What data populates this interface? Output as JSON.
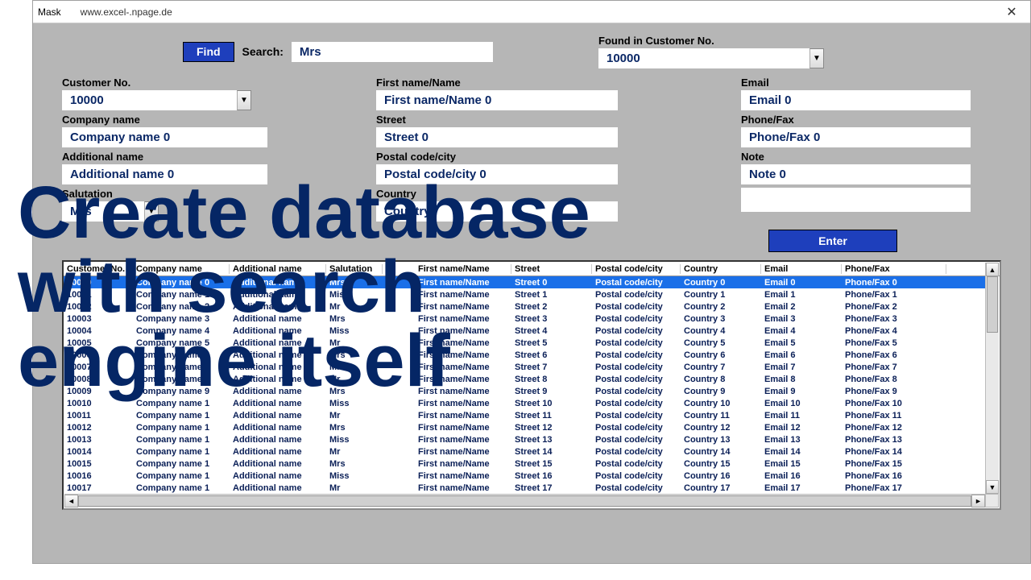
{
  "window": {
    "title": "Mask",
    "url": "www.excel-.npage.de"
  },
  "top": {
    "find_label": "Find",
    "search_label": "Search:",
    "search_value": "Mrs",
    "found_label": "Found in Customer No.",
    "found_value": "10000"
  },
  "fields": {
    "customer_label": "Customer No.",
    "customer_value": "10000",
    "company_label": "Company name",
    "company_value": "Company name 0",
    "addname_label": "Additional name",
    "addname_value": "Additional name 0",
    "salutation_label": "Salutation",
    "salutation_value": "Mrs",
    "firstname_label": "First name/Name",
    "firstname_value": "First name/Name 0",
    "street_label": "Street",
    "street_value": "Street 0",
    "postal_label": "Postal code/city",
    "postal_value": "Postal code/city 0",
    "country_label": "Country",
    "country_value": "Country",
    "email_label": "Email",
    "email_value": "Email 0",
    "phone_label": "Phone/Fax",
    "phone_value": "Phone/Fax 0",
    "note_label": "Note",
    "note_value": "Note 0",
    "enter_label": "Enter"
  },
  "headers": [
    "Customer No.",
    "Company name",
    "Additional name",
    "Salutation",
    "",
    "First name/Name",
    "Street",
    "Postal code/city",
    "Country",
    "Email",
    "Phone/Fax"
  ],
  "rows": [
    {
      "id": "10000",
      "co": "Company name 0",
      "ad": "Additional name",
      "sal": "Mrs",
      "fn": "First name/Name",
      "st": "Street 0",
      "pc": "Postal code/city",
      "cn": "Country 0",
      "em": "Email 0",
      "ph": "Phone/Fax 0",
      "sel": true
    },
    {
      "id": "10001",
      "co": "Company name 1",
      "ad": "Additional name",
      "sal": "Miss",
      "fn": "First name/Name",
      "st": "Street 1",
      "pc": "Postal code/city",
      "cn": "Country 1",
      "em": "Email 1",
      "ph": "Phone/Fax 1"
    },
    {
      "id": "10002",
      "co": "Company name 2",
      "ad": "Additional name",
      "sal": "Mr",
      "fn": "First name/Name",
      "st": "Street 2",
      "pc": "Postal code/city",
      "cn": "Country 2",
      "em": "Email 2",
      "ph": "Phone/Fax 2"
    },
    {
      "id": "10003",
      "co": "Company name 3",
      "ad": "Additional name",
      "sal": "Mrs",
      "fn": "First name/Name",
      "st": "Street 3",
      "pc": "Postal code/city",
      "cn": "Country 3",
      "em": "Email 3",
      "ph": "Phone/Fax 3"
    },
    {
      "id": "10004",
      "co": "Company name 4",
      "ad": "Additional name",
      "sal": "Miss",
      "fn": "First name/Name",
      "st": "Street 4",
      "pc": "Postal code/city",
      "cn": "Country 4",
      "em": "Email 4",
      "ph": "Phone/Fax 4"
    },
    {
      "id": "10005",
      "co": "Company name 5",
      "ad": "Additional name",
      "sal": "Mr",
      "fn": "First name/Name",
      "st": "Street 5",
      "pc": "Postal code/city",
      "cn": "Country 5",
      "em": "Email 5",
      "ph": "Phone/Fax 5"
    },
    {
      "id": "10006",
      "co": "Company name 6",
      "ad": "Additional name",
      "sal": "Mrs",
      "fn": "First name/Name",
      "st": "Street 6",
      "pc": "Postal code/city",
      "cn": "Country 6",
      "em": "Email 6",
      "ph": "Phone/Fax 6"
    },
    {
      "id": "10007",
      "co": "Company name 7",
      "ad": "Additional name",
      "sal": "Miss",
      "fn": "First name/Name",
      "st": "Street 7",
      "pc": "Postal code/city",
      "cn": "Country 7",
      "em": "Email 7",
      "ph": "Phone/Fax 7"
    },
    {
      "id": "10008",
      "co": "Company name 8",
      "ad": "Additional name",
      "sal": "Mr",
      "fn": "First name/Name",
      "st": "Street 8",
      "pc": "Postal code/city",
      "cn": "Country 8",
      "em": "Email 8",
      "ph": "Phone/Fax 8"
    },
    {
      "id": "10009",
      "co": "Company name 9",
      "ad": "Additional name",
      "sal": "Mrs",
      "fn": "First name/Name",
      "st": "Street 9",
      "pc": "Postal code/city",
      "cn": "Country 9",
      "em": "Email 9",
      "ph": "Phone/Fax 9"
    },
    {
      "id": "10010",
      "co": "Company name 1",
      "ad": "Additional name",
      "sal": "Miss",
      "fn": "First name/Name",
      "st": "Street 10",
      "pc": "Postal code/city",
      "cn": "Country 10",
      "em": "Email 10",
      "ph": "Phone/Fax 10"
    },
    {
      "id": "10011",
      "co": "Company name 1",
      "ad": "Additional name",
      "sal": "Mr",
      "fn": "First name/Name",
      "st": "Street 11",
      "pc": "Postal code/city",
      "cn": "Country 11",
      "em": "Email 11",
      "ph": "Phone/Fax 11"
    },
    {
      "id": "10012",
      "co": "Company name 1",
      "ad": "Additional name",
      "sal": "Mrs",
      "fn": "First name/Name",
      "st": "Street 12",
      "pc": "Postal code/city",
      "cn": "Country 12",
      "em": "Email 12",
      "ph": "Phone/Fax 12"
    },
    {
      "id": "10013",
      "co": "Company name 1",
      "ad": "Additional name",
      "sal": "Miss",
      "fn": "First name/Name",
      "st": "Street 13",
      "pc": "Postal code/city",
      "cn": "Country 13",
      "em": "Email 13",
      "ph": "Phone/Fax 13"
    },
    {
      "id": "10014",
      "co": "Company name 1",
      "ad": "Additional name",
      "sal": "Mr",
      "fn": "First name/Name",
      "st": "Street 14",
      "pc": "Postal code/city",
      "cn": "Country 14",
      "em": "Email 14",
      "ph": "Phone/Fax 14"
    },
    {
      "id": "10015",
      "co": "Company name 1",
      "ad": "Additional name",
      "sal": "Mrs",
      "fn": "First name/Name",
      "st": "Street 15",
      "pc": "Postal code/city",
      "cn": "Country 15",
      "em": "Email 15",
      "ph": "Phone/Fax 15"
    },
    {
      "id": "10016",
      "co": "Company name 1",
      "ad": "Additional name",
      "sal": "Miss",
      "fn": "First name/Name",
      "st": "Street 16",
      "pc": "Postal code/city",
      "cn": "Country 16",
      "em": "Email 16",
      "ph": "Phone/Fax 16"
    },
    {
      "id": "10017",
      "co": "Company name 1",
      "ad": "Additional name",
      "sal": "Mr",
      "fn": "First name/Name",
      "st": "Street 17",
      "pc": "Postal code/city",
      "cn": "Country 17",
      "em": "Email 17",
      "ph": "Phone/Fax 17"
    }
  ],
  "overlay": "Create database\nwith search\nengine itself"
}
